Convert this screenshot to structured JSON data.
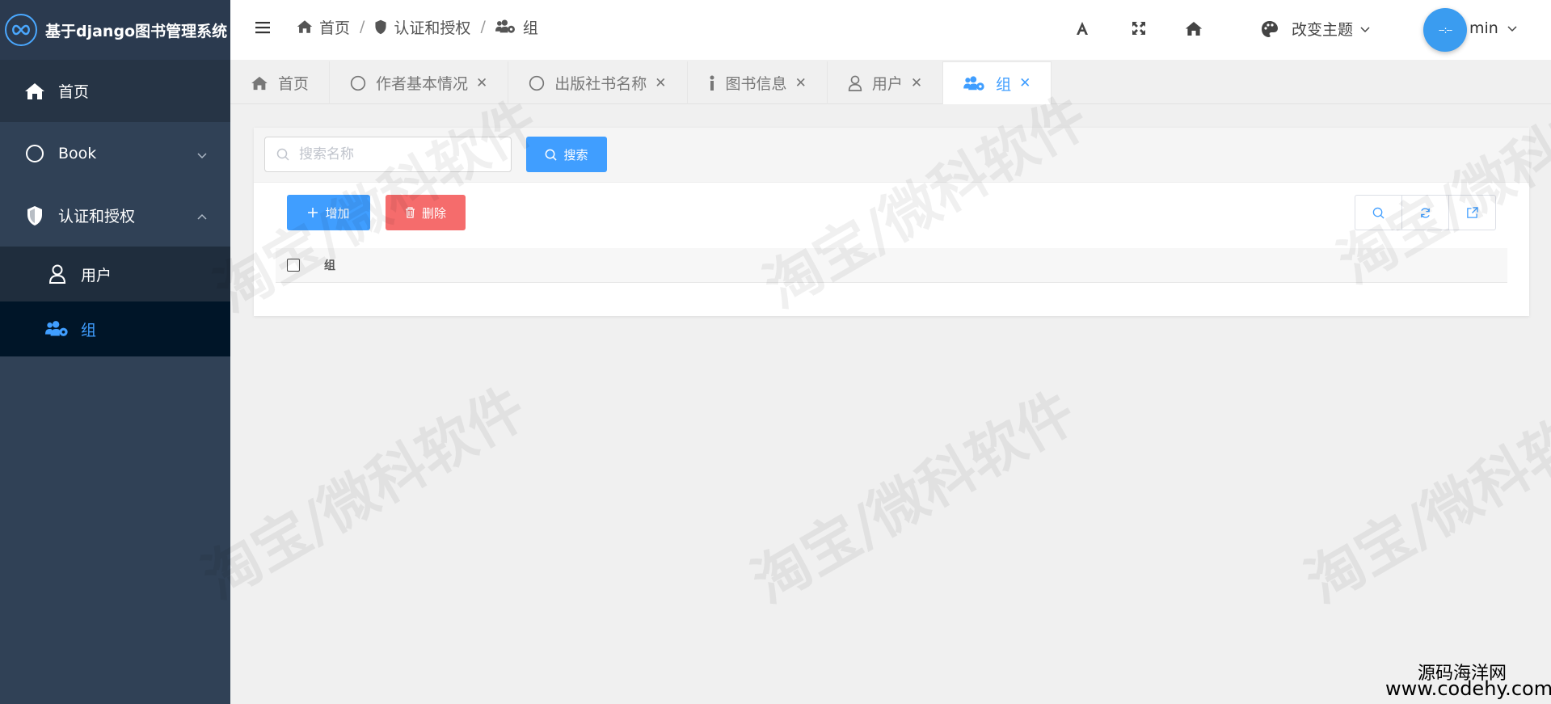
{
  "app": {
    "title": "基于django图书管理系统"
  },
  "sidebar": {
    "items": [
      {
        "label": "首页"
      },
      {
        "label": "Book"
      },
      {
        "label": "认证和授权"
      }
    ],
    "subitems": [
      {
        "label": "用户"
      },
      {
        "label": "组"
      }
    ]
  },
  "breadcrumb": {
    "items": [
      {
        "label": "首页"
      },
      {
        "label": "认证和授权"
      },
      {
        "label": "组"
      }
    ],
    "separator": "/"
  },
  "header": {
    "theme_label": "改变主题",
    "avatar_text": "--:--",
    "username": "min"
  },
  "tabs": [
    {
      "label": "首页"
    },
    {
      "label": "作者基本情况"
    },
    {
      "label": "出版社书名称"
    },
    {
      "label": "图书信息"
    },
    {
      "label": "用户"
    },
    {
      "label": "组"
    }
  ],
  "toolbar": {
    "search_placeholder": "搜索名称",
    "search_label": "搜索",
    "add_label": "增加",
    "delete_label": "删除"
  },
  "table": {
    "columns": [
      "组"
    ],
    "rows": []
  },
  "watermark": {
    "text": "淘宝/微科软件"
  },
  "credit": {
    "line1": "源码海洋网",
    "line2": "www.codehy.com"
  },
  "colors": {
    "sidebar_bg": "#304156",
    "primary": "#409eff",
    "danger": "#f56c6c",
    "active_submenu_bg": "#001528"
  }
}
